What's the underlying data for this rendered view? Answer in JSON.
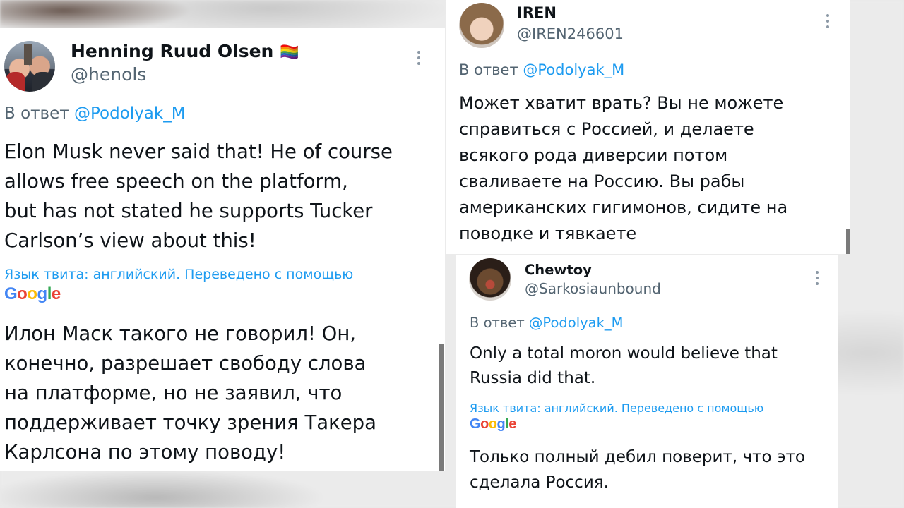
{
  "tweets": [
    {
      "name": "Henning Ruud Olsen",
      "flag": "🏳️‍🌈",
      "handle": "@henols",
      "reply_prefix": "В ответ",
      "reply_to": "@Podolyak_M",
      "body": "Elon Musk never said that! He of course\nallows free speech on the platform,\nbut has not stated he supports Tucker\nCarlson’s view about this!",
      "translated_label": "Язык твита: английский. Переведено с помощью",
      "translation": "Илон Маск такого не говорил! Он,\nконечно, разрешает свободу слова\nна платформе, но не заявил, что\nподдерживает точку зрения Такера\nКарлсона по этому поводу!"
    },
    {
      "name": "IREN",
      "handle": "@IREN246601",
      "reply_prefix": "В ответ",
      "reply_to": "@Podolyak_M",
      "body": "Может хватит врать? Вы не можете\nсправиться с Россией, и делаете\nвсякого рода диверсии потом\nсваливаете на Россию. Вы рабы\nамериканских гигимонов, сидите на\nповодке и тявкаете"
    },
    {
      "name": "Chewtoy",
      "handle": "@Sarkosiaunbound",
      "reply_prefix": "В ответ",
      "reply_to": "@Podolyak_M",
      "body": "Only a total moron would believe that\nRussia did that.",
      "translated_label": "Язык твита: английский. Переведено с помощью",
      "translation": "Только полный дебил поверит, что это\nсделала Россия."
    }
  ],
  "google_logo": {
    "g1": "G",
    "g2": "o",
    "g3": "o",
    "g4": "g",
    "g5": "l",
    "g6": "e"
  }
}
